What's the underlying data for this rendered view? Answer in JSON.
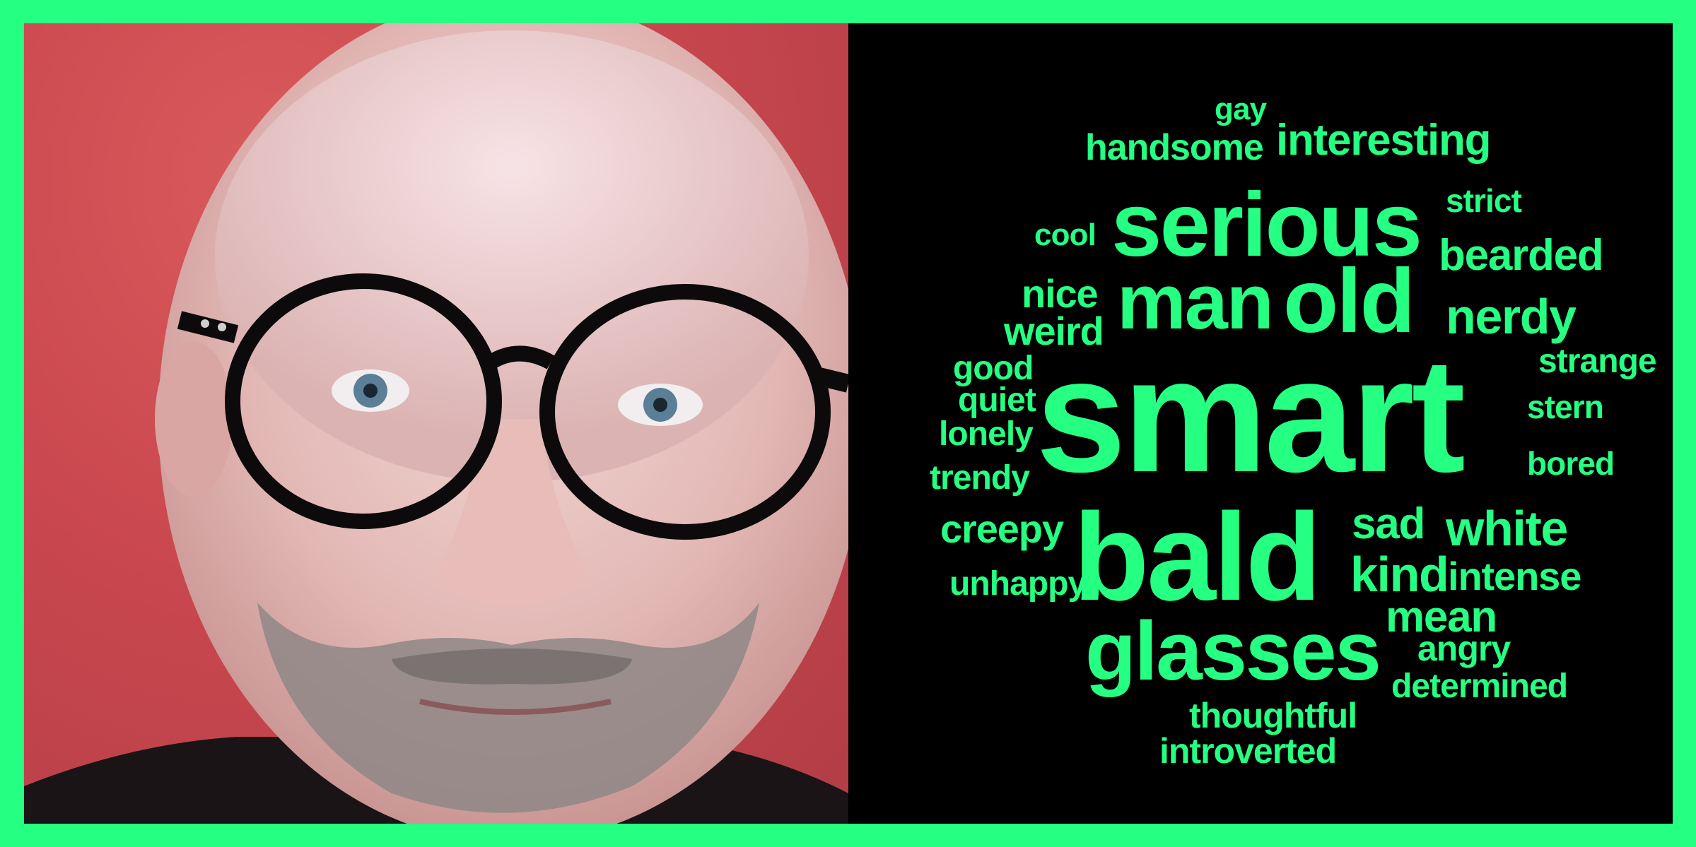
{
  "colors": {
    "border": "#25ff82",
    "word_color": "#25ff82",
    "cloud_background": "#000000",
    "photo_background": "#c9474e"
  },
  "photo": {
    "icon": "portrait-photo"
  },
  "word_cloud": {
    "words": [
      "gay",
      "handsome",
      "interesting",
      "strict",
      "cool",
      "serious",
      "bearded",
      "nice",
      "man",
      "old",
      "weird",
      "nerdy",
      "good",
      "strange",
      "quiet",
      "smart",
      "stern",
      "lonely",
      "bored",
      "trendy",
      "sad",
      "creepy",
      "bald",
      "white",
      "kind",
      "intense",
      "unhappy",
      "mean",
      "glasses",
      "angry",
      "determined",
      "thoughtful",
      "introverted"
    ]
  }
}
